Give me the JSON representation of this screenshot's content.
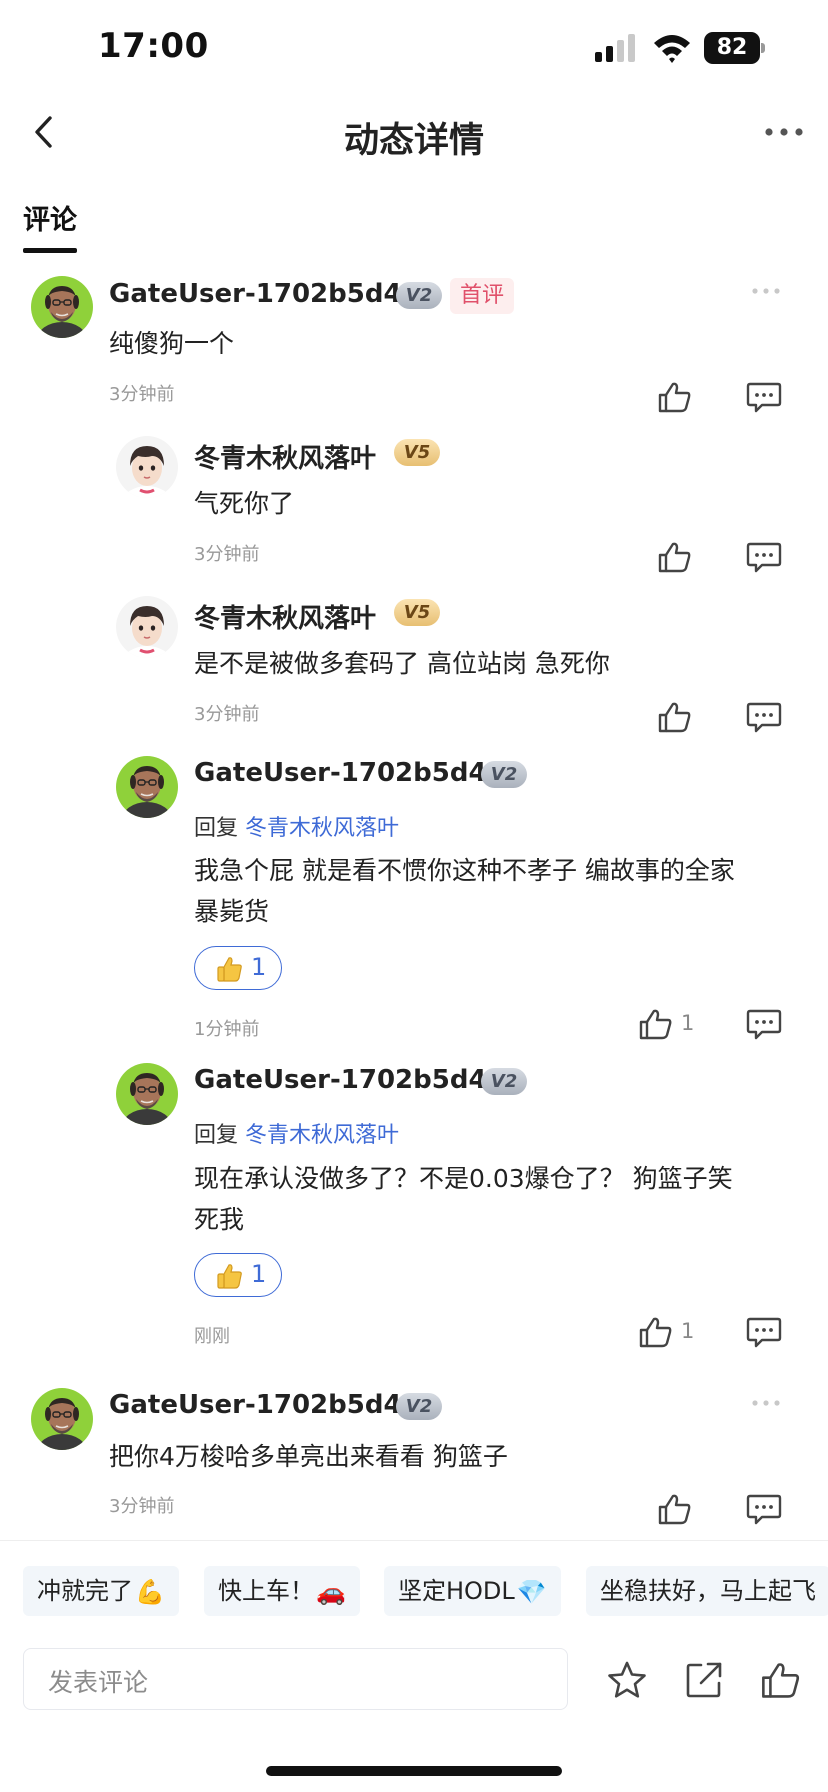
{
  "status": {
    "time": "17:00",
    "battery": "82"
  },
  "nav": {
    "title": "动态详情",
    "back_icon": "chevron-left-icon",
    "more_icon": "more-horizontal-icon"
  },
  "tabs": [
    {
      "label": "评论",
      "active": true
    }
  ],
  "comments": [
    {
      "user": "GateUser-1702b5d4",
      "level": "V2",
      "badge": "首评",
      "text": "纯傻狗一个",
      "time": "3分钟前",
      "likes": ""
    },
    {
      "user": "冬青木秋风落叶",
      "level": "V5",
      "text": "气死你了",
      "time": "3分钟前",
      "likes": ""
    },
    {
      "user": "冬青木秋风落叶",
      "level": "V5",
      "text": "是不是被做多套码了 高位站岗 急死你",
      "time": "3分钟前",
      "likes": ""
    },
    {
      "user": "GateUser-1702b5d4",
      "level": "V2",
      "reply_prefix": "回复",
      "reply_target": "冬青木秋风落叶",
      "text_line1": "我急个屁 就是看不惯你这种不孝子 编故事的全家",
      "text_line2": "暴毙货",
      "reaction_count": "1",
      "time": "1分钟前",
      "likes": "1"
    },
    {
      "user": "GateUser-1702b5d4",
      "level": "V2",
      "reply_prefix": "回复",
      "reply_target": "冬青木秋风落叶",
      "text_line1": "现在承认没做多了？不是0.03爆仓了？ 狗篮子笑",
      "text_line2": "死我",
      "reaction_count": "1",
      "time": "刚刚",
      "likes": "1"
    },
    {
      "user": "GateUser-1702b5d4",
      "level": "V2",
      "text": "把你4万梭哈多单亮出来看看 狗篮子",
      "time": "3分钟前",
      "likes": ""
    }
  ],
  "quick_replies": [
    {
      "label": "冲就完了",
      "emoji": "💪"
    },
    {
      "label": "快上车！",
      "emoji": "🚗"
    },
    {
      "label": "坚定HODL",
      "emoji": "💎"
    },
    {
      "label": "坐稳扶好，马上起飞",
      "emoji": ""
    }
  ],
  "composer": {
    "placeholder": "发表评论"
  },
  "icons": {
    "like": "thumbs-up-icon",
    "reply": "comment-bubble-icon",
    "star": "star-icon",
    "share": "share-icon"
  },
  "colors": {
    "link": "#3e6ad6",
    "first_badge_bg": "#fdeeee",
    "first_badge_text": "#e0506a",
    "chip_bg": "#f2f6fa"
  }
}
